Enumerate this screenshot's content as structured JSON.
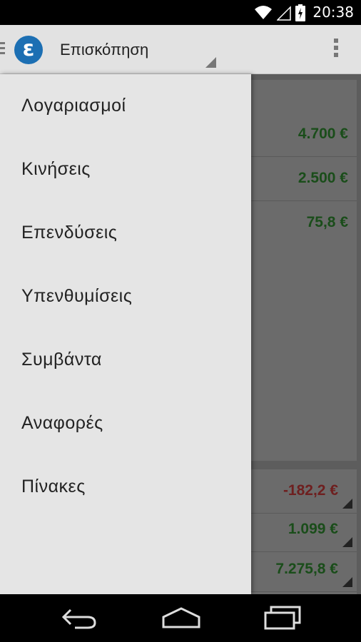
{
  "status_bar": {
    "time": "20:38",
    "icons": [
      "wifi-icon",
      "signal-icon",
      "battery-charging-icon"
    ]
  },
  "action_bar": {
    "logo_letter": "ε",
    "title": "Επισκόπηση",
    "icons": [
      "drawer-indicator-icon",
      "spinner-arrow-icon",
      "overflow-menu-icon"
    ]
  },
  "drawer": {
    "items": [
      {
        "label": "Λογαριασμοί"
      },
      {
        "label": "Κινήσεις"
      },
      {
        "label": "Επενδύσεις"
      },
      {
        "label": "Υπενθυμίσεις"
      },
      {
        "label": "Συμβάντα"
      },
      {
        "label": "Αναφορές"
      },
      {
        "label": "Πίνακες"
      }
    ]
  },
  "content": {
    "accounts": [
      {
        "amount": "4.700 €"
      },
      {
        "amount": "2.500 €"
      },
      {
        "amount": "75,8 €"
      }
    ],
    "summary": [
      {
        "amount": "-182,2 €",
        "negative": true
      },
      {
        "amount": "1.099 €"
      },
      {
        "amount": "7.275,8 €"
      }
    ]
  },
  "colors": {
    "positive": "#1a4d1a",
    "negative": "#6e1f1f",
    "logo": "#1c6fb3"
  },
  "nav_bar": {
    "icons": [
      "back-icon",
      "home-icon",
      "recent-apps-icon"
    ]
  }
}
